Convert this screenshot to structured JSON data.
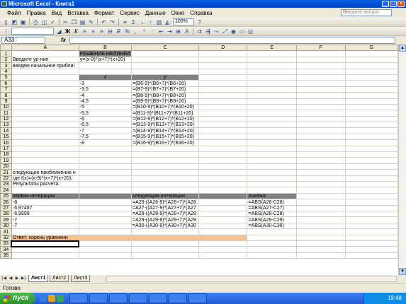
{
  "window": {
    "title": "Microsoft Excel - Книга1"
  },
  "menu": [
    "Файл",
    "Правка",
    "Вид",
    "Вставка",
    "Формат",
    "Сервис",
    "Данные",
    "Окно",
    "Справка"
  ],
  "ask_placeholder": "Введите вопрос",
  "zoom": "100%",
  "namebox": "A33",
  "fx_label": "fx",
  "columns": [
    "A",
    "B",
    "C",
    "D",
    "E",
    "F",
    "G"
  ],
  "rows": [
    {
      "n": "1",
      "cells": [
        "",
        "РЕШЕНИЕ НЕЛИНЕЙ",
        "",
        "",
        "",
        "",
        ""
      ]
    },
    {
      "n": "2",
      "cells": [
        "Введите ур-ние",
        "y=(x-9)*(x+7)*(x+20)",
        "",
        "",
        "",
        "",
        ""
      ]
    },
    {
      "n": "3",
      "cells": [
        "введем начальное приблиі",
        "",
        "",
        "",
        "",
        "",
        ""
      ]
    },
    {
      "n": "4",
      "cells": [
        "",
        "",
        "",
        "",
        "",
        "",
        ""
      ]
    },
    {
      "n": "5",
      "cells": [
        "",
        "x",
        "y",
        "",
        "",
        "",
        ""
      ]
    },
    {
      "n": "6",
      "cells": [
        "",
        "-3",
        "=(B6-9)*(B6+7)*(B6+20)",
        "",
        "",
        "",
        ""
      ]
    },
    {
      "n": "7",
      "cells": [
        "",
        "-3,5",
        "=(B7-9)*(B7+7)*(B7+20)",
        "",
        "",
        "",
        ""
      ]
    },
    {
      "n": "8",
      "cells": [
        "",
        "-4",
        "=(B8-9)*(B8+7)*(B8+20)",
        "",
        "",
        "",
        ""
      ]
    },
    {
      "n": "9",
      "cells": [
        "",
        "-4,5",
        "=(B9-9)*(B9+7)*(B9+20)",
        "",
        "",
        "",
        ""
      ]
    },
    {
      "n": "10",
      "cells": [
        "",
        "-5",
        "=(B10-9)*(B10+7)*(B10+20)",
        "",
        "",
        "",
        ""
      ]
    },
    {
      "n": "11",
      "cells": [
        "",
        "-5,5",
        "=(B11-9)*(B11+7)*(B11+20)",
        "",
        "",
        "",
        ""
      ]
    },
    {
      "n": "12",
      "cells": [
        "",
        "-6",
        "=(B12-9)*(B12+7)*(B12+20)",
        "",
        "",
        "",
        ""
      ]
    },
    {
      "n": "13",
      "cells": [
        "",
        "-6,5",
        "=(B13-9)*(B13+7)*(B13+20)",
        "",
        "",
        "",
        ""
      ]
    },
    {
      "n": "14",
      "cells": [
        "",
        "-7",
        "=(B14-9)*(B14+7)*(B14+20)",
        "",
        "",
        "",
        ""
      ]
    },
    {
      "n": "15",
      "cells": [
        "",
        "-7,5",
        "=(B15-9)*(B15+7)*(B15+20)",
        "",
        "",
        "",
        ""
      ]
    },
    {
      "n": "16",
      "cells": [
        "",
        "-8",
        "=(B16-9)*(B16+7)*(B16+20)",
        "",
        "",
        "",
        ""
      ]
    },
    {
      "n": "17",
      "cells": [
        "",
        "",
        "",
        "",
        "",
        "",
        ""
      ]
    },
    {
      "n": "18",
      "cells": [
        "",
        "",
        "",
        "",
        "",
        "",
        ""
      ]
    },
    {
      "n": "19",
      "cells": [
        "",
        "",
        "",
        "",
        "",
        "",
        ""
      ]
    },
    {
      "n": "20",
      "cells": [
        "",
        "",
        "",
        "",
        "",
        "",
        ""
      ]
    },
    {
      "n": "21",
      "cells": [
        "следующее приближение н",
        "",
        "",
        "",
        "",
        "",
        ""
      ]
    },
    {
      "n": "22",
      "cells": [
        "где  f(x)=(x-9)*(x+7)*(x+20);",
        "",
        "",
        "",
        "",
        "",
        ""
      ]
    },
    {
      "n": "23",
      "cells": [
        "Результаты расчета.",
        "",
        "",
        "",
        "",
        "",
        ""
      ]
    },
    {
      "n": "24",
      "cells": [
        "",
        "",
        "",
        "",
        "",
        "",
        ""
      ]
    },
    {
      "n": "25",
      "cells": [
        "первая интерация",
        "",
        "следующая интерация",
        "",
        "ошибка",
        "",
        ""
      ]
    },
    {
      "n": "26",
      "cells": [
        "-8",
        "",
        "=A26-((A26-9)*(A26+7)*(A26",
        "",
        "=ABS(A26-C26)",
        "",
        ""
      ]
    },
    {
      "n": "27",
      "cells": [
        "-6,97487",
        "",
        "=A27-((A27-9)*(A27+7)*(A27",
        "",
        "=ABS(A27-C27)",
        "",
        ""
      ]
    },
    {
      "n": "28",
      "cells": [
        "-6,9999",
        "",
        "=A28-((A28-9)*(A28+7)*(A28",
        "",
        "=ABS(A28-C28)",
        "",
        ""
      ]
    },
    {
      "n": "29",
      "cells": [
        "-7",
        "",
        "=A29-((A29-9)*(A29+7)*(A29",
        "",
        "=ABS(A29-C29)",
        "",
        ""
      ]
    },
    {
      "n": "30",
      "cells": [
        "-7",
        "",
        "=A30-((A30-9)*(A30+7)*(A30",
        "",
        "=ABS(A30-C30)",
        "",
        ""
      ]
    },
    {
      "n": "31",
      "cells": [
        "",
        "",
        "",
        "",
        "",
        "",
        ""
      ]
    },
    {
      "n": "32",
      "cells": [
        "Ответ:      корень уравнени",
        "",
        "",
        "",
        "",
        "",
        ""
      ]
    },
    {
      "n": "33",
      "cells": [
        "",
        "",
        "",
        "",
        "",
        "",
        ""
      ]
    },
    {
      "n": "34",
      "cells": [
        "",
        "",
        "",
        "",
        "",
        "",
        ""
      ]
    },
    {
      "n": "35",
      "cells": [
        "",
        "",
        "",
        "",
        "",
        "",
        ""
      ]
    }
  ],
  "sheet_tabs": [
    "Лист1",
    "Лист2",
    "Лист3"
  ],
  "status": "Готово",
  "taskbar": {
    "start": "пуск",
    "clock": "19:48"
  }
}
